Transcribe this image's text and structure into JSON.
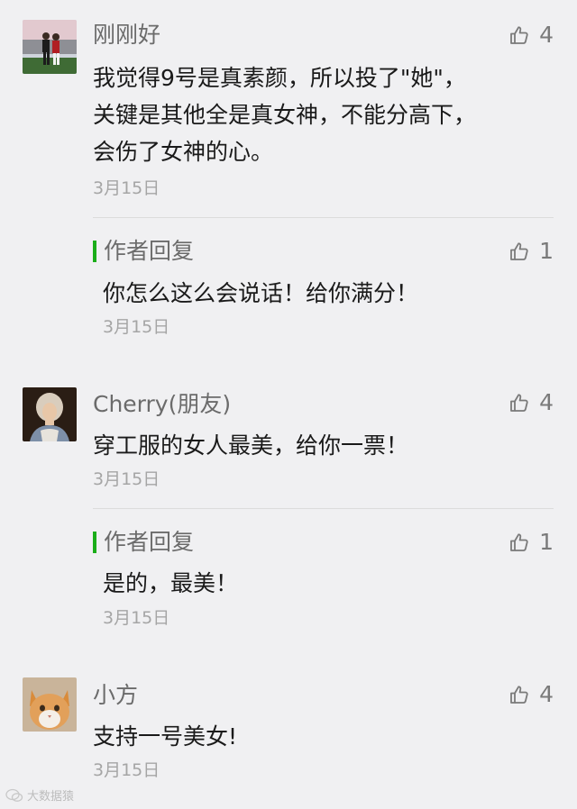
{
  "comments": [
    {
      "nickname": "刚刚好",
      "avatar_icon": "soccer-players-avatar",
      "text": "我觉得9号是真素颜，所以投了\"她\"，\n关键是其他全是真女神，不能分高下，\n会伤了女神的心。",
      "date": "3月15日",
      "likes": "4",
      "reply": {
        "title": "作者回复",
        "text": "你怎么这么会说话！给你满分！",
        "date": "3月15日",
        "likes": "1"
      }
    },
    {
      "nickname": "Cherry(朋友)",
      "avatar_icon": "portrait-painting-avatar",
      "text": "穿工服的女人最美，给你一票！",
      "date": "3月15日",
      "likes": "4",
      "reply": {
        "title": "作者回复",
        "text": "是的，最美！",
        "date": "3月15日",
        "likes": "1"
      }
    },
    {
      "nickname": "小方",
      "avatar_icon": "cat-avatar",
      "text": "支持一号美女!",
      "date": "3月15日",
      "likes": "4"
    }
  ],
  "colors": {
    "background": "#f0f0f2",
    "reply_accent": "#1aad19",
    "meta_text": "#a5a5a5"
  },
  "watermark": {
    "icon": "wechat-logo-icon",
    "text": "大数据猿"
  }
}
